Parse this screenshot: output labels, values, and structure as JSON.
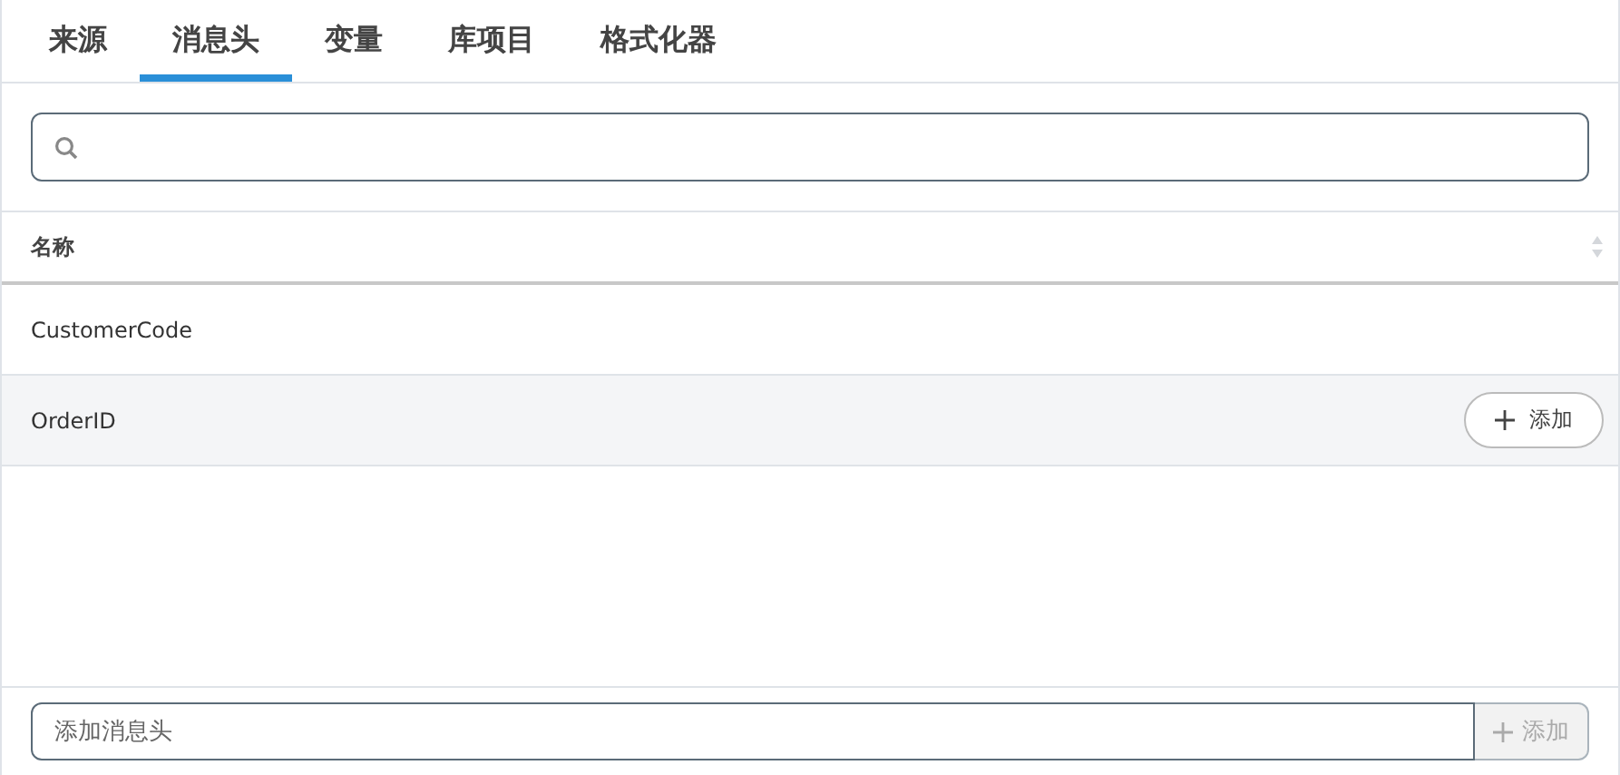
{
  "tabs": [
    {
      "label": "来源",
      "selected": false
    },
    {
      "label": "消息头",
      "selected": true
    },
    {
      "label": "变量",
      "selected": false
    },
    {
      "label": "库项目",
      "selected": false
    },
    {
      "label": "格式化器",
      "selected": false
    }
  ],
  "table": {
    "columns": [
      {
        "label": "名称",
        "sortable": true
      }
    ],
    "rows": [
      {
        "name": "CustomerCode",
        "hovered": false
      },
      {
        "name": "OrderID",
        "hovered": true
      }
    ],
    "row_action": "添加"
  },
  "footer": {
    "placeholder": "添加消息头",
    "button": {
      "label": "添加",
      "disabled": true
    }
  }
}
